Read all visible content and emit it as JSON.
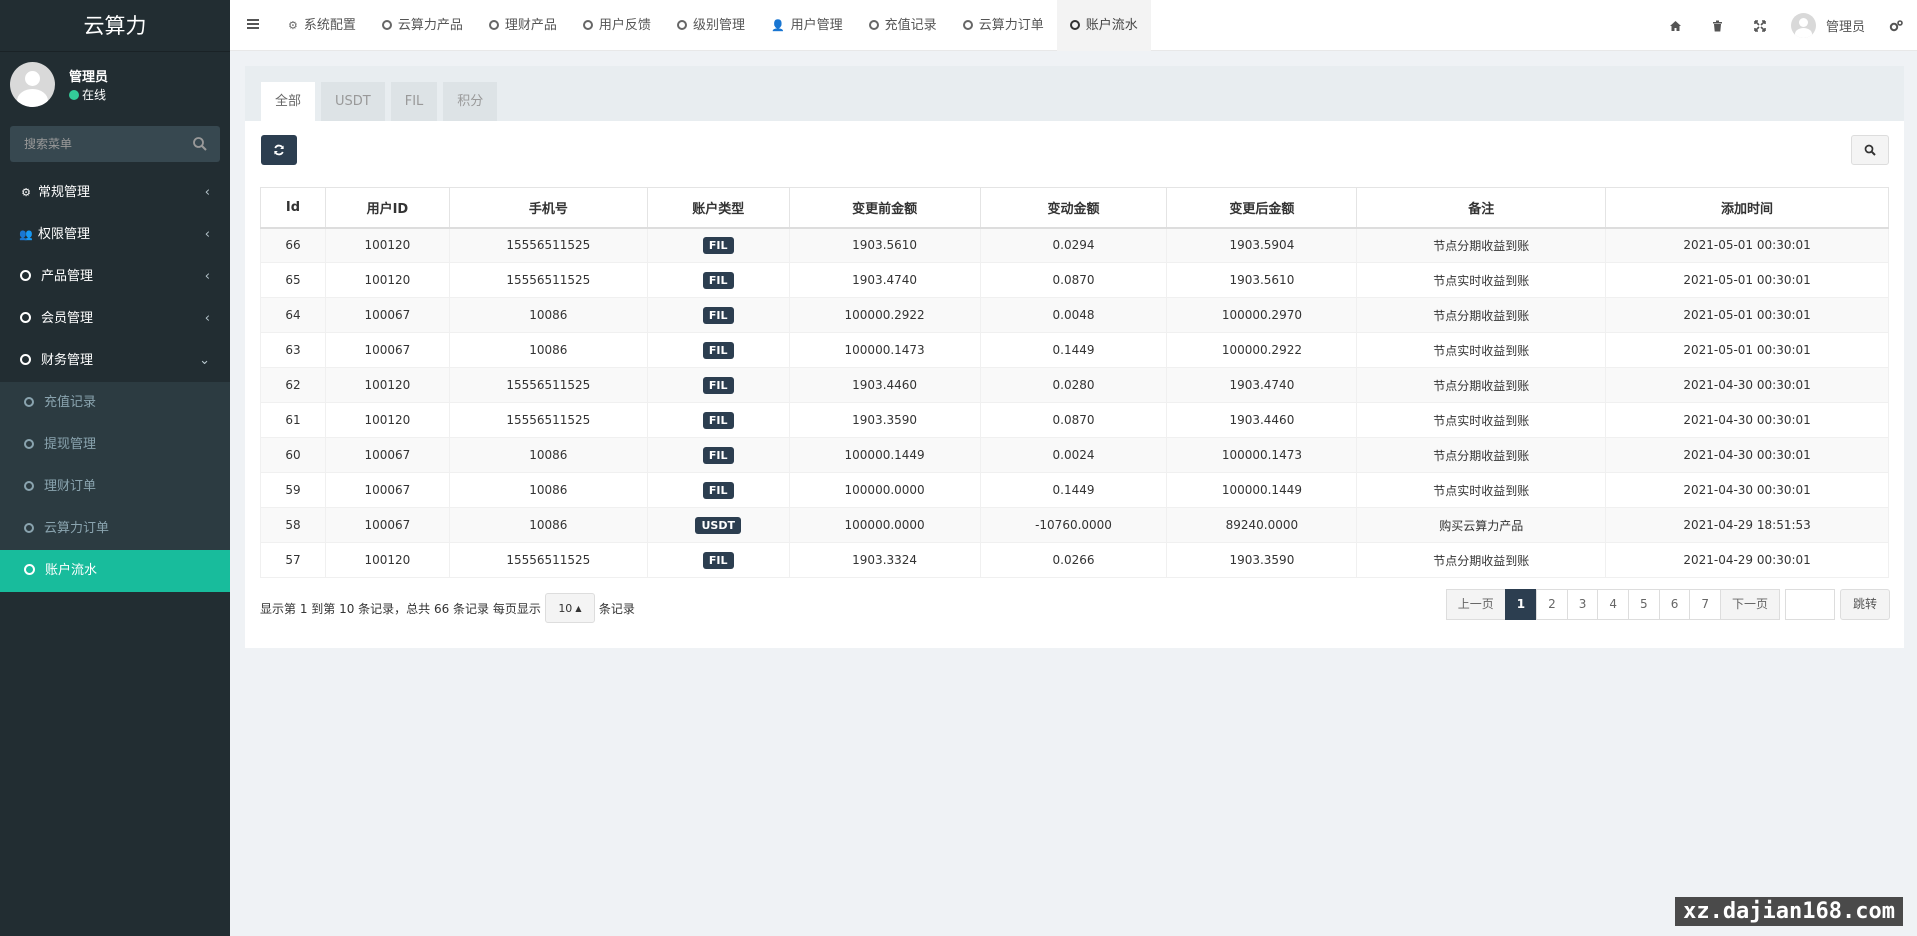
{
  "app": {
    "logo": "云算力"
  },
  "user": {
    "name": "管理员",
    "status": "在线"
  },
  "sidebar": {
    "search_placeholder": "搜索菜单",
    "items": [
      {
        "label": "常规管理",
        "icon": "cogs-icon",
        "type": "top",
        "arrow": "‹"
      },
      {
        "label": "权限管理",
        "icon": "group-icon",
        "type": "top",
        "arrow": "‹"
      },
      {
        "label": "产品管理",
        "icon": "circle-icon",
        "type": "top",
        "arrow": "‹"
      },
      {
        "label": "会员管理",
        "icon": "circle-icon",
        "type": "top",
        "arrow": "‹"
      },
      {
        "label": "财务管理",
        "icon": "circle-icon",
        "type": "open",
        "arrow": "⌄"
      },
      {
        "label": "充值记录",
        "icon": "circle-icon",
        "type": "sub"
      },
      {
        "label": "提现管理",
        "icon": "circle-icon",
        "type": "sub"
      },
      {
        "label": "理财订单",
        "icon": "circle-icon",
        "type": "sub"
      },
      {
        "label": "云算力订单",
        "icon": "circle-icon",
        "type": "sub"
      },
      {
        "label": "账户流水",
        "icon": "circle-icon",
        "type": "active"
      }
    ]
  },
  "header": {
    "tabs": [
      {
        "label": "系统配置",
        "icon": "gear-icon"
      },
      {
        "label": "云算力产品",
        "icon": "circle-icon"
      },
      {
        "label": "理财产品",
        "icon": "circle-icon"
      },
      {
        "label": "用户反馈",
        "icon": "circle-icon"
      },
      {
        "label": "级别管理",
        "icon": "circle-icon"
      },
      {
        "label": "用户管理",
        "icon": "user-icon"
      },
      {
        "label": "充值记录",
        "icon": "circle-icon"
      },
      {
        "label": "云算力订单",
        "icon": "circle-icon"
      },
      {
        "label": "账户流水",
        "icon": "circle-icon"
      }
    ],
    "user_name": "管理员"
  },
  "panel": {
    "tabs": [
      "全部",
      "USDT",
      "FIL",
      "积分"
    ]
  },
  "table": {
    "columns": [
      "Id",
      "用户ID",
      "手机号",
      "账户类型",
      "变更前金额",
      "变动金额",
      "变更后金额",
      "备注",
      "添加时间"
    ],
    "rows": [
      [
        "66",
        "100120",
        "15556511525",
        "FIL",
        "1903.5610",
        "0.0294",
        "1903.5904",
        "节点分期收益到账",
        "2021-05-01 00:30:01"
      ],
      [
        "65",
        "100120",
        "15556511525",
        "FIL",
        "1903.4740",
        "0.0870",
        "1903.5610",
        "节点实时收益到账",
        "2021-05-01 00:30:01"
      ],
      [
        "64",
        "100067",
        "10086",
        "FIL",
        "100000.2922",
        "0.0048",
        "100000.2970",
        "节点分期收益到账",
        "2021-05-01 00:30:01"
      ],
      [
        "63",
        "100067",
        "10086",
        "FIL",
        "100000.1473",
        "0.1449",
        "100000.2922",
        "节点实时收益到账",
        "2021-05-01 00:30:01"
      ],
      [
        "62",
        "100120",
        "15556511525",
        "FIL",
        "1903.4460",
        "0.0280",
        "1903.4740",
        "节点分期收益到账",
        "2021-04-30 00:30:01"
      ],
      [
        "61",
        "100120",
        "15556511525",
        "FIL",
        "1903.3590",
        "0.0870",
        "1903.4460",
        "节点实时收益到账",
        "2021-04-30 00:30:01"
      ],
      [
        "60",
        "100067",
        "10086",
        "FIL",
        "100000.1449",
        "0.0024",
        "100000.1473",
        "节点分期收益到账",
        "2021-04-30 00:30:01"
      ],
      [
        "59",
        "100067",
        "10086",
        "FIL",
        "100000.0000",
        "0.1449",
        "100000.1449",
        "节点实时收益到账",
        "2021-04-30 00:30:01"
      ],
      [
        "58",
        "100067",
        "10086",
        "USDT",
        "100000.0000",
        "-10760.0000",
        "89240.0000",
        "购买云算力产品",
        "2021-04-29 18:51:53"
      ],
      [
        "57",
        "100120",
        "15556511525",
        "FIL",
        "1903.3324",
        "0.0266",
        "1903.3590",
        "节点分期收益到账",
        "2021-04-29 00:30:01"
      ]
    ]
  },
  "footer": {
    "summary": "显示第 1 到第 10 条记录，总共 66 条记录 每页显示",
    "page_size": "10",
    "records_suffix": "条记录",
    "prev": "上一页",
    "next": "下一页",
    "pages": [
      "1",
      "2",
      "3",
      "4",
      "5",
      "6",
      "7"
    ],
    "current_page": "1",
    "jump": "跳转"
  },
  "watermark": "xz.dajian168.com"
}
